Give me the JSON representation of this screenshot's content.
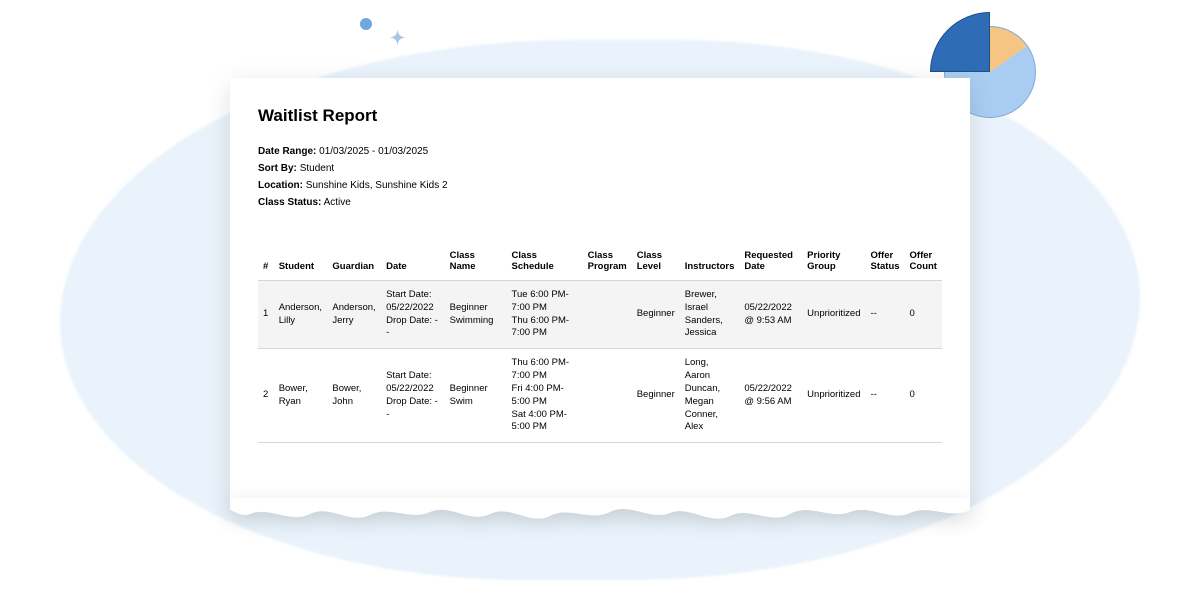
{
  "report": {
    "title": "Waitlist Report",
    "meta": {
      "date_range_label": "Date Range:",
      "date_range_value": "01/03/2025 - 01/03/2025",
      "sort_by_label": "Sort By:",
      "sort_by_value": "Student",
      "location_label": "Location:",
      "location_value": "Sunshine Kids, Sunshine Kids 2",
      "class_status_label": "Class Status:",
      "class_status_value": "Active"
    },
    "columns": {
      "num": "#",
      "student": "Student",
      "guardian": "Guardian",
      "date": "Date",
      "class_name": "Class Name",
      "class_schedule": "Class Schedule",
      "class_program": "Class Program",
      "class_level": "Class Level",
      "instructors": "Instructors",
      "requested_date": "Requested Date",
      "priority_group": "Priority Group",
      "offer_status": "Offer Status",
      "offer_count": "Offer Count"
    },
    "rows": [
      {
        "num": "1",
        "student": "Anderson, Lilly",
        "guardian": "Anderson, Jerry",
        "date": "Start Date: 05/22/2022 Drop Date: --",
        "class_name": "Beginner Swimming",
        "class_schedule": "Tue 6:00 PM-7:00 PM\nThu 6:00 PM-7:00 PM",
        "class_program": "",
        "class_level": "Beginner",
        "instructors": "Brewer, Israel\nSanders, Jessica",
        "requested_date": "05/22/2022 @ 9:53 AM",
        "priority_group": "Unprioritized",
        "offer_status": "--",
        "offer_count": "0"
      },
      {
        "num": "2",
        "student": "Bower, Ryan",
        "guardian": "Bower, John",
        "date": "Start Date: 05/22/2022 Drop Date: --",
        "class_name": "Beginner Swim",
        "class_schedule": "Thu 6:00 PM-7:00 PM\nFri 4:00 PM-5:00 PM\nSat 4:00 PM-5:00 PM",
        "class_program": "",
        "class_level": "Beginner",
        "instructors": "Long, Aaron\nDuncan, Megan\nConner, Alex",
        "requested_date": "05/22/2022 @ 9:56 AM",
        "priority_group": "Unprioritized",
        "offer_status": "--",
        "offer_count": "0"
      }
    ]
  },
  "chart_data": {
    "type": "pie",
    "note": "decorative pie chart – proportions estimated",
    "series": [
      {
        "name": "slice-dark-blue",
        "value": 25,
        "color": "#2e6cb5"
      },
      {
        "name": "slice-orange",
        "value": 15,
        "color": "#f6c583"
      },
      {
        "name": "slice-light-blue",
        "value": 60,
        "color": "#a9cdf2"
      }
    ]
  }
}
